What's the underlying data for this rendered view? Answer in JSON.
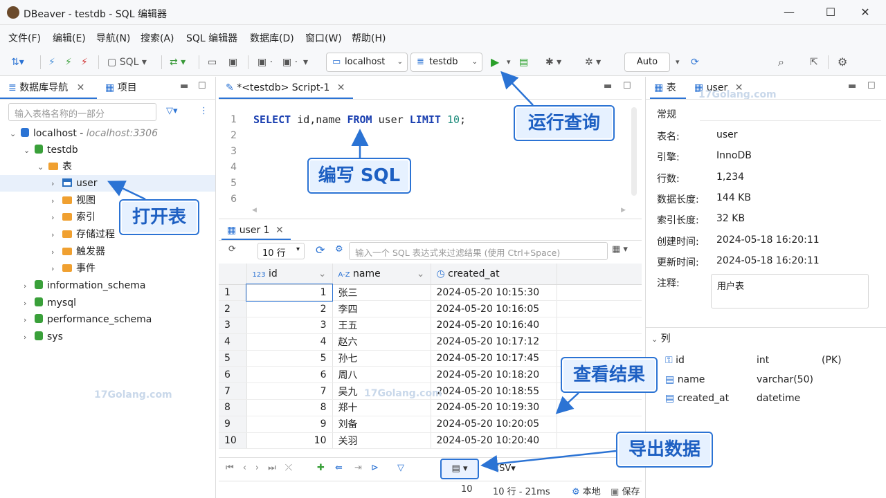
{
  "window": {
    "title": "DBeaver - testdb - SQL 编辑器",
    "minimize": "—",
    "maximize": "☐",
    "close": "✕"
  },
  "menu": [
    "文件(F)",
    "编辑(E)",
    "导航(N)",
    "搜索(A)",
    "SQL 编辑器",
    "数据库(D)",
    "窗口(W)",
    "帮助(H)"
  ],
  "toolbar": {
    "sql_label": "SQL",
    "connection": "localhost",
    "database": "testdb",
    "mode": "Auto"
  },
  "navigator": {
    "tab_db": "数据库导航",
    "tab_project": "项目",
    "filter_placeholder": "输入表格名称的一部分",
    "tree": [
      {
        "label": "localhost",
        "host": "localhost:3306"
      },
      {
        "label": "testdb"
      },
      {
        "label": "表"
      },
      {
        "label": "user"
      },
      {
        "label": "视图"
      },
      {
        "label": "索引"
      },
      {
        "label": "存储过程"
      },
      {
        "label": "触发器"
      },
      {
        "label": "事件"
      },
      {
        "label": "information_schema"
      },
      {
        "label": "mysql"
      },
      {
        "label": "performance_schema"
      },
      {
        "label": "sys"
      }
    ]
  },
  "editor": {
    "tab": "*<testdb> Script-1",
    "lines": [
      "1",
      "2",
      "3",
      "4",
      "5",
      "6"
    ],
    "sql": {
      "kw1": "SELECT",
      "cols": " id,name ",
      "kw2": "FROM",
      "tbl": " user ",
      "kw3": "LIMIT",
      "num": " 10",
      "end": ";"
    }
  },
  "results": {
    "tab": "user 1",
    "limit": "10 行",
    "filter_placeholder": "输入一个 SQL 表达式来过滤结果 (使用 Ctrl+Space)",
    "columns": [
      {
        "type": "123",
        "name": "id"
      },
      {
        "type": "A-Z",
        "name": "name"
      },
      {
        "type": "",
        "name": "created_at"
      }
    ],
    "rows": [
      [
        "1",
        "1",
        "张三",
        "2024-05-20 10:15:30"
      ],
      [
        "2",
        "2",
        "李四",
        "2024-05-20 10:16:05"
      ],
      [
        "3",
        "3",
        "王五",
        "2024-05-20 10:16:40"
      ],
      [
        "4",
        "4",
        "赵六",
        "2024-05-20 10:17:12"
      ],
      [
        "5",
        "5",
        "孙七",
        "2024-05-20 10:17:45"
      ],
      [
        "6",
        "6",
        "周八",
        "2024-05-20 10:18:20"
      ],
      [
        "7",
        "7",
        "吴九",
        "2024-05-20 10:18:55"
      ],
      [
        "8",
        "8",
        "郑十",
        "2024-05-20 10:19:30"
      ],
      [
        "9",
        "9",
        "刘备",
        "2024-05-20 10:20:05"
      ],
      [
        "10",
        "10",
        "关羽",
        "2024-05-20 10:20:40"
      ]
    ],
    "export_format": "CSV",
    "status": {
      "count": "10",
      "summary": "10 行 - 21ms",
      "local": "本地",
      "save": "保存"
    }
  },
  "properties": {
    "tab_table": "表",
    "tab_user": "user",
    "section": "常规",
    "fields": [
      {
        "label": "表名:",
        "value": "user"
      },
      {
        "label": "引擎:",
        "value": "InnoDB"
      },
      {
        "label": "行数:",
        "value": "1,234"
      },
      {
        "label": "数据长度:",
        "value": "144 KB"
      },
      {
        "label": "索引长度:",
        "value": "32 KB"
      },
      {
        "label": "创建时间:",
        "value": "2024-05-18 16:20:11"
      },
      {
        "label": "更新时间:",
        "value": "2024-05-18 16:20:11"
      }
    ],
    "comment_label": "注释:",
    "comment": "用户表",
    "columns_section": "列",
    "columns": [
      {
        "name": "id",
        "type": "int",
        "key": "(PK)"
      },
      {
        "name": "name",
        "type": "varchar(50)",
        "key": ""
      },
      {
        "name": "created_at",
        "type": "datetime",
        "key": ""
      }
    ]
  },
  "annotations": {
    "run_query": "运行查询",
    "write_sql": "编写 SQL",
    "open_table": "打开表",
    "view_results": "查看结果",
    "export_data": "导出数据"
  },
  "watermark": "17Golang.com",
  "colors": {
    "accent": "#2b73d4",
    "keyword": "#1a3fb0",
    "run": "#2aa02a"
  }
}
